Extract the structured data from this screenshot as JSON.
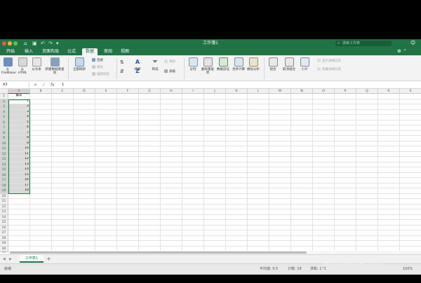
{
  "window": {
    "title": "工作簿1",
    "search_placeholder": "搜索工作表"
  },
  "tabs": [
    {
      "label": "开始",
      "active": false
    },
    {
      "label": "插入",
      "active": false
    },
    {
      "label": "页面布局",
      "active": false
    },
    {
      "label": "公式",
      "active": false
    },
    {
      "label": "数据",
      "active": true
    },
    {
      "label": "审阅",
      "active": false
    },
    {
      "label": "视图",
      "active": false
    }
  ],
  "ribbon": {
    "from_filemaker": "从 FileMaker",
    "from_html": "从 HTML",
    "from_text": "从文本",
    "new_query": "新建数据库查询",
    "refresh_all": "全部刷新",
    "connections": "连接",
    "properties": "属性",
    "edit_links": "编辑链接",
    "sort_az": "A Z",
    "sort": "排序",
    "filter": "筛选",
    "clear": "清除",
    "advanced": "高级",
    "text_to_columns": "分列",
    "remove_duplicates": "删除重复项",
    "data_validation": "数据验证",
    "consolidate": "合并计算",
    "what_if": "模拟分析",
    "group": "组合",
    "ungroup": "取消组合",
    "subtotal": "小计",
    "show_detail": "显示详细信息",
    "hide_detail": "隐藏详细信息"
  },
  "formula_bar": {
    "name_box": "A3",
    "fx": "fx",
    "value": "1"
  },
  "columns": [
    "A",
    "B",
    "C",
    "D",
    "E",
    "F",
    "G",
    "H",
    "I",
    "J",
    "K",
    "L",
    "M",
    "N",
    "O",
    "P",
    "Q",
    "R",
    "S"
  ],
  "rows": [
    "1",
    "2",
    "3",
    "4",
    "5",
    "6",
    "7",
    "8",
    "9",
    "10",
    "11",
    "12",
    "13",
    "14",
    "15",
    "16",
    "17",
    "18",
    "19",
    "20",
    "21",
    "22",
    "23",
    "24",
    "25",
    "26",
    "27",
    "28",
    "29",
    "30",
    "31"
  ],
  "column_a": {
    "header": "编号",
    "values": [
      "1",
      "2",
      "3",
      "4",
      "5",
      "6",
      "7",
      "8",
      "9",
      "10",
      "11",
      "12",
      "13",
      "14",
      "15",
      "16",
      "17",
      "18"
    ]
  },
  "sheets": [
    {
      "label": "工作表1"
    }
  ],
  "add_sheet": "+",
  "status": {
    "mode": "就绪",
    "average": "平均值: 9.5",
    "count": "计数: 18",
    "sum": "求和: 171",
    "zoom": "100%"
  },
  "watermark": "爱创根知识网",
  "colors": {
    "accent": "#217346"
  }
}
